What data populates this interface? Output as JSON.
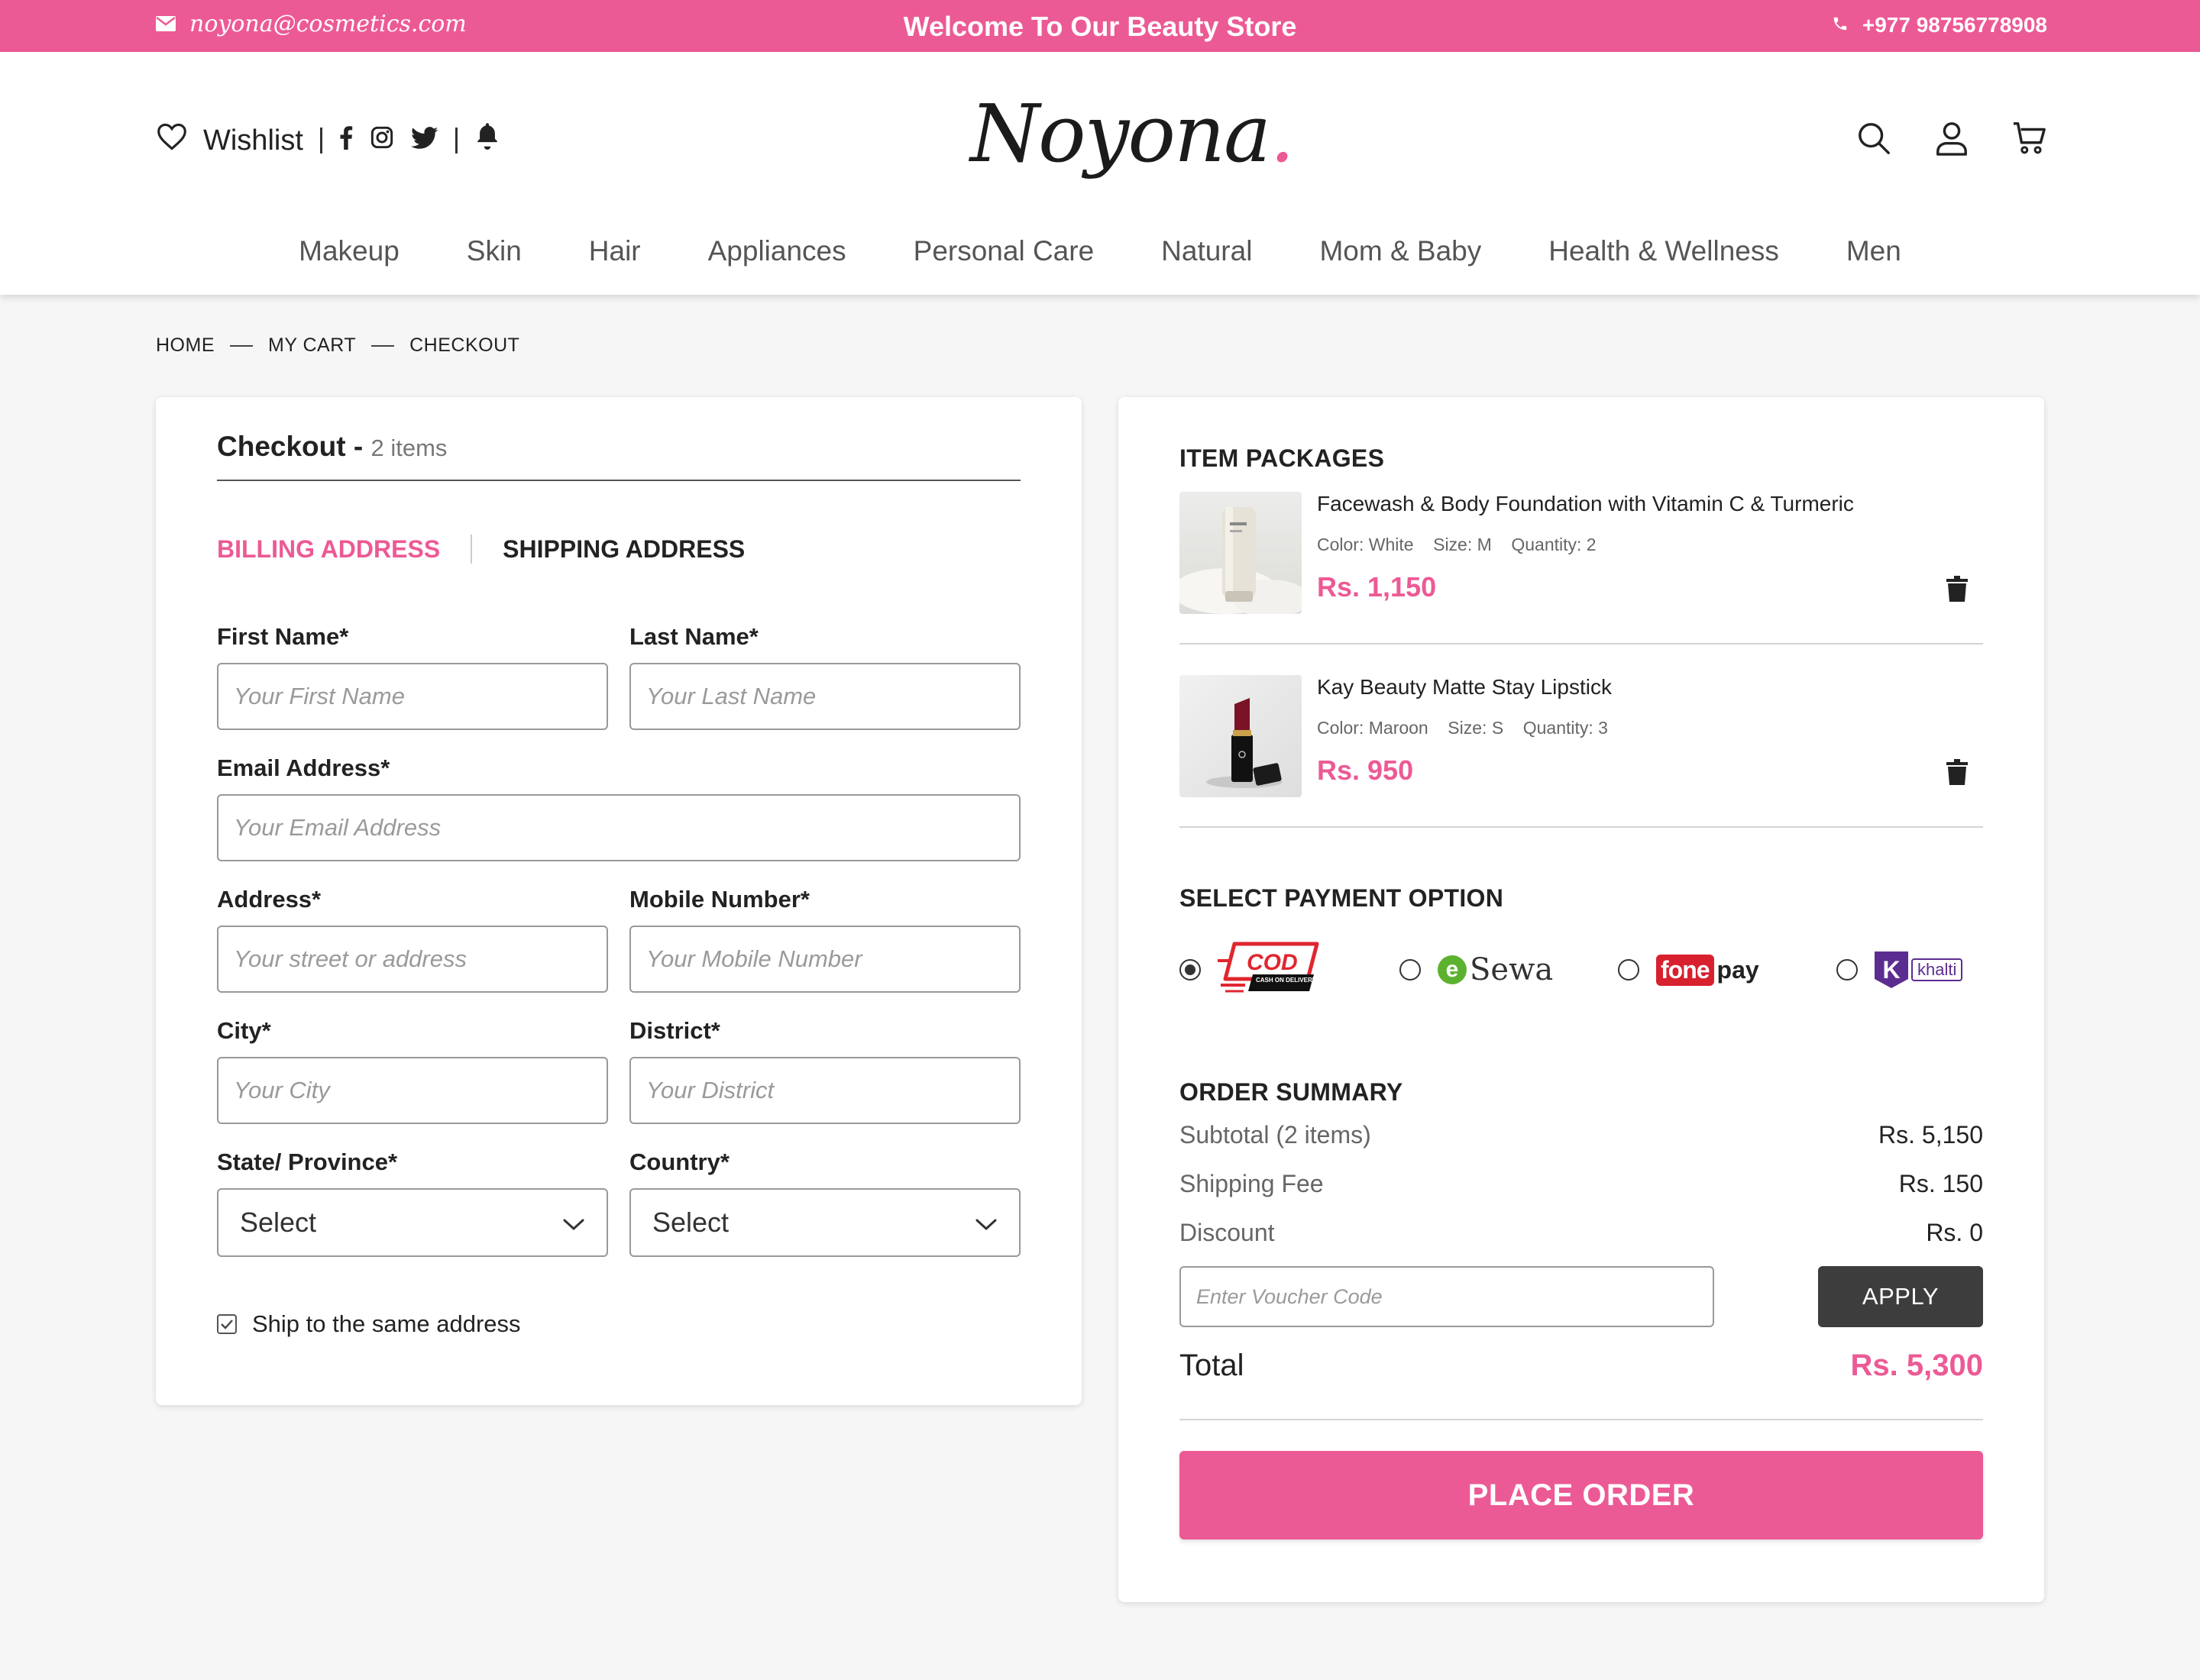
{
  "topbar": {
    "email": "noyona@cosmetics.com",
    "welcome": "Welcome To Our Beauty Store",
    "phone": "+977 98756778908",
    "bg_color": "#ec5a95"
  },
  "header": {
    "wishlist_label": "Wishlist",
    "logo_text": "Noyona",
    "logo_dot": ".",
    "icons": [
      "heart-icon",
      "facebook-icon",
      "instagram-icon",
      "twitter-icon",
      "bell-icon",
      "search-icon",
      "user-icon",
      "cart-icon"
    ]
  },
  "nav": [
    "Makeup",
    "Skin",
    "Hair",
    "Appliances",
    "Personal Care",
    "Natural",
    "Mom & Baby",
    "Health & Wellness",
    "Men"
  ],
  "breadcrumb": [
    "HOME",
    "MY CART",
    "CHECKOUT"
  ],
  "checkout": {
    "title": "Checkout - ",
    "items_count": "2 items",
    "tabs": {
      "billing": "BILLING ADDRESS",
      "shipping": "SHIPPING ADDRESS"
    },
    "fields": {
      "first_name": {
        "label": "First Name*",
        "placeholder": "Your First Name"
      },
      "last_name": {
        "label": "Last Name*",
        "placeholder": "Your Last Name"
      },
      "email": {
        "label": "Email Address*",
        "placeholder": "Your Email Address"
      },
      "address": {
        "label": "Address*",
        "placeholder": "Your street or address"
      },
      "mobile": {
        "label": "Mobile Number*",
        "placeholder": "Your Mobile Number"
      },
      "city": {
        "label": "City*",
        "placeholder": "Your City"
      },
      "district": {
        "label": "District*",
        "placeholder": "Your District"
      },
      "state": {
        "label": "State/ Province*",
        "value": "Select"
      },
      "country": {
        "label": "Country*",
        "value": "Select"
      }
    },
    "ship_same": {
      "label": "Ship to the same address",
      "checked": true
    }
  },
  "packages": {
    "title": "ITEM PACKAGES",
    "items": [
      {
        "name": "Facewash & Body Foundation with Vitamin C & Turmeric",
        "color": "Color: White",
        "size": "Size: M",
        "quantity": "Quantity: 2",
        "price": "Rs. 1,150"
      },
      {
        "name": "Kay Beauty Matte Stay Lipstick",
        "color": "Color: Maroon",
        "size": "Size: S",
        "quantity": "Quantity: 3",
        "price": "Rs. 950"
      }
    ]
  },
  "payment": {
    "title": "SELECT PAYMENT OPTION",
    "options": [
      {
        "name": "COD",
        "sub": "CASH ON DELIVERY",
        "selected": true
      },
      {
        "name": "Sewa",
        "prefix": "e",
        "selected": false
      },
      {
        "name": "pay",
        "prefix": "fone",
        "selected": false
      },
      {
        "name": "khalti",
        "prefix": "K",
        "selected": false
      }
    ]
  },
  "summary": {
    "title": "ORDER SUMMARY",
    "subtotal_label": "Subtotal (2 items)",
    "subtotal_value": "Rs. 5,150",
    "shipping_label": "Shipping Fee",
    "shipping_value": "Rs. 150",
    "discount_label": "Discount",
    "discount_value": "Rs. 0",
    "voucher_placeholder": "Enter Voucher Code",
    "apply_label": "APPLY",
    "total_label": "Total",
    "total_value": "Rs. 5,300",
    "place_order_label": "PLACE ORDER"
  }
}
